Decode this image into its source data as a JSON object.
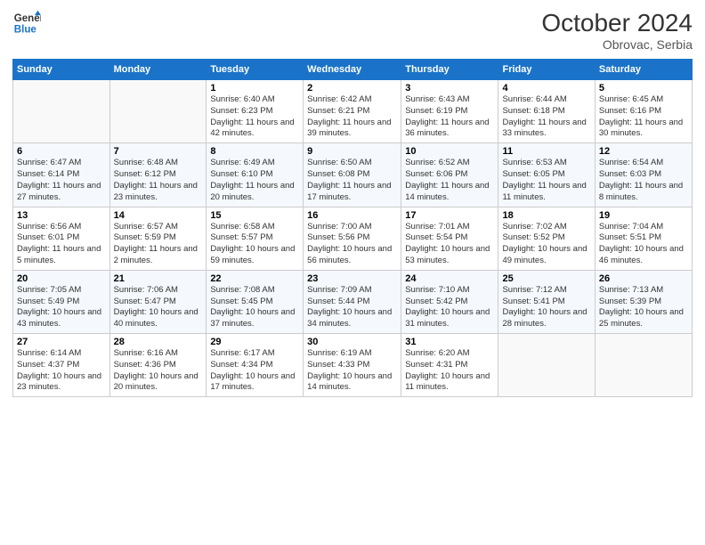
{
  "header": {
    "logo_line1": "General",
    "logo_line2": "Blue",
    "month": "October 2024",
    "location": "Obrovac, Serbia"
  },
  "weekdays": [
    "Sunday",
    "Monday",
    "Tuesday",
    "Wednesday",
    "Thursday",
    "Friday",
    "Saturday"
  ],
  "weeks": [
    [
      {
        "day": "",
        "sunrise": "",
        "sunset": "",
        "daylight": ""
      },
      {
        "day": "",
        "sunrise": "",
        "sunset": "",
        "daylight": ""
      },
      {
        "day": "1",
        "sunrise": "Sunrise: 6:40 AM",
        "sunset": "Sunset: 6:23 PM",
        "daylight": "Daylight: 11 hours and 42 minutes."
      },
      {
        "day": "2",
        "sunrise": "Sunrise: 6:42 AM",
        "sunset": "Sunset: 6:21 PM",
        "daylight": "Daylight: 11 hours and 39 minutes."
      },
      {
        "day": "3",
        "sunrise": "Sunrise: 6:43 AM",
        "sunset": "Sunset: 6:19 PM",
        "daylight": "Daylight: 11 hours and 36 minutes."
      },
      {
        "day": "4",
        "sunrise": "Sunrise: 6:44 AM",
        "sunset": "Sunset: 6:18 PM",
        "daylight": "Daylight: 11 hours and 33 minutes."
      },
      {
        "day": "5",
        "sunrise": "Sunrise: 6:45 AM",
        "sunset": "Sunset: 6:16 PM",
        "daylight": "Daylight: 11 hours and 30 minutes."
      }
    ],
    [
      {
        "day": "6",
        "sunrise": "Sunrise: 6:47 AM",
        "sunset": "Sunset: 6:14 PM",
        "daylight": "Daylight: 11 hours and 27 minutes."
      },
      {
        "day": "7",
        "sunrise": "Sunrise: 6:48 AM",
        "sunset": "Sunset: 6:12 PM",
        "daylight": "Daylight: 11 hours and 23 minutes."
      },
      {
        "day": "8",
        "sunrise": "Sunrise: 6:49 AM",
        "sunset": "Sunset: 6:10 PM",
        "daylight": "Daylight: 11 hours and 20 minutes."
      },
      {
        "day": "9",
        "sunrise": "Sunrise: 6:50 AM",
        "sunset": "Sunset: 6:08 PM",
        "daylight": "Daylight: 11 hours and 17 minutes."
      },
      {
        "day": "10",
        "sunrise": "Sunrise: 6:52 AM",
        "sunset": "Sunset: 6:06 PM",
        "daylight": "Daylight: 11 hours and 14 minutes."
      },
      {
        "day": "11",
        "sunrise": "Sunrise: 6:53 AM",
        "sunset": "Sunset: 6:05 PM",
        "daylight": "Daylight: 11 hours and 11 minutes."
      },
      {
        "day": "12",
        "sunrise": "Sunrise: 6:54 AM",
        "sunset": "Sunset: 6:03 PM",
        "daylight": "Daylight: 11 hours and 8 minutes."
      }
    ],
    [
      {
        "day": "13",
        "sunrise": "Sunrise: 6:56 AM",
        "sunset": "Sunset: 6:01 PM",
        "daylight": "Daylight: 11 hours and 5 minutes."
      },
      {
        "day": "14",
        "sunrise": "Sunrise: 6:57 AM",
        "sunset": "Sunset: 5:59 PM",
        "daylight": "Daylight: 11 hours and 2 minutes."
      },
      {
        "day": "15",
        "sunrise": "Sunrise: 6:58 AM",
        "sunset": "Sunset: 5:57 PM",
        "daylight": "Daylight: 10 hours and 59 minutes."
      },
      {
        "day": "16",
        "sunrise": "Sunrise: 7:00 AM",
        "sunset": "Sunset: 5:56 PM",
        "daylight": "Daylight: 10 hours and 56 minutes."
      },
      {
        "day": "17",
        "sunrise": "Sunrise: 7:01 AM",
        "sunset": "Sunset: 5:54 PM",
        "daylight": "Daylight: 10 hours and 53 minutes."
      },
      {
        "day": "18",
        "sunrise": "Sunrise: 7:02 AM",
        "sunset": "Sunset: 5:52 PM",
        "daylight": "Daylight: 10 hours and 49 minutes."
      },
      {
        "day": "19",
        "sunrise": "Sunrise: 7:04 AM",
        "sunset": "Sunset: 5:51 PM",
        "daylight": "Daylight: 10 hours and 46 minutes."
      }
    ],
    [
      {
        "day": "20",
        "sunrise": "Sunrise: 7:05 AM",
        "sunset": "Sunset: 5:49 PM",
        "daylight": "Daylight: 10 hours and 43 minutes."
      },
      {
        "day": "21",
        "sunrise": "Sunrise: 7:06 AM",
        "sunset": "Sunset: 5:47 PM",
        "daylight": "Daylight: 10 hours and 40 minutes."
      },
      {
        "day": "22",
        "sunrise": "Sunrise: 7:08 AM",
        "sunset": "Sunset: 5:45 PM",
        "daylight": "Daylight: 10 hours and 37 minutes."
      },
      {
        "day": "23",
        "sunrise": "Sunrise: 7:09 AM",
        "sunset": "Sunset: 5:44 PM",
        "daylight": "Daylight: 10 hours and 34 minutes."
      },
      {
        "day": "24",
        "sunrise": "Sunrise: 7:10 AM",
        "sunset": "Sunset: 5:42 PM",
        "daylight": "Daylight: 10 hours and 31 minutes."
      },
      {
        "day": "25",
        "sunrise": "Sunrise: 7:12 AM",
        "sunset": "Sunset: 5:41 PM",
        "daylight": "Daylight: 10 hours and 28 minutes."
      },
      {
        "day": "26",
        "sunrise": "Sunrise: 7:13 AM",
        "sunset": "Sunset: 5:39 PM",
        "daylight": "Daylight: 10 hours and 25 minutes."
      }
    ],
    [
      {
        "day": "27",
        "sunrise": "Sunrise: 6:14 AM",
        "sunset": "Sunset: 4:37 PM",
        "daylight": "Daylight: 10 hours and 23 minutes."
      },
      {
        "day": "28",
        "sunrise": "Sunrise: 6:16 AM",
        "sunset": "Sunset: 4:36 PM",
        "daylight": "Daylight: 10 hours and 20 minutes."
      },
      {
        "day": "29",
        "sunrise": "Sunrise: 6:17 AM",
        "sunset": "Sunset: 4:34 PM",
        "daylight": "Daylight: 10 hours and 17 minutes."
      },
      {
        "day": "30",
        "sunrise": "Sunrise: 6:19 AM",
        "sunset": "Sunset: 4:33 PM",
        "daylight": "Daylight: 10 hours and 14 minutes."
      },
      {
        "day": "31",
        "sunrise": "Sunrise: 6:20 AM",
        "sunset": "Sunset: 4:31 PM",
        "daylight": "Daylight: 10 hours and 11 minutes."
      },
      {
        "day": "",
        "sunrise": "",
        "sunset": "",
        "daylight": ""
      },
      {
        "day": "",
        "sunrise": "",
        "sunset": "",
        "daylight": ""
      }
    ]
  ]
}
